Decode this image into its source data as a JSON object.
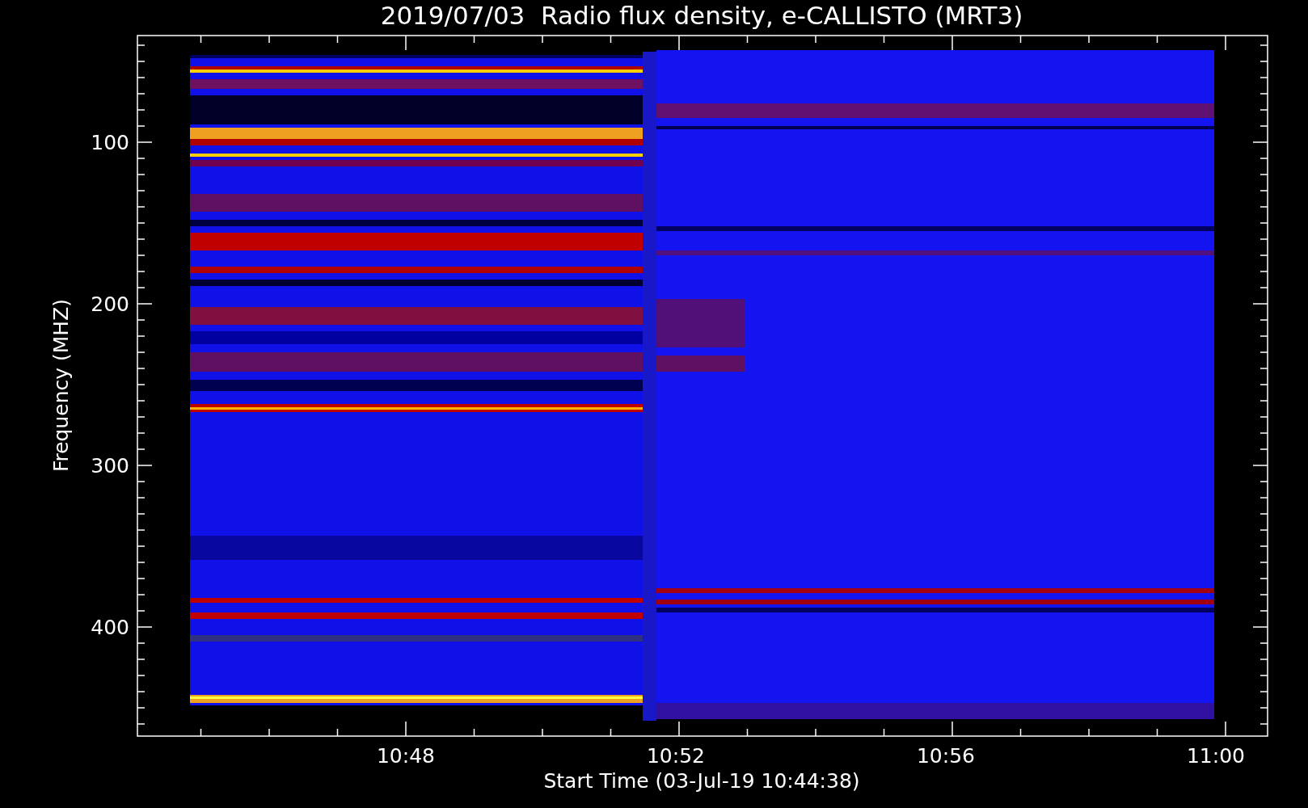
{
  "title": "2019/07/03  Radio flux density, e-CALLISTO (MRT3)",
  "y_axis": {
    "label": "Frequency (MHZ)",
    "ticks": [
      "100",
      "200",
      "300",
      "400"
    ]
  },
  "x_axis": {
    "label": "Start Time (03-Jul-19 10:44:38)",
    "ticks": [
      "10:48",
      "10:52",
      "10:56",
      "11:00"
    ]
  }
}
